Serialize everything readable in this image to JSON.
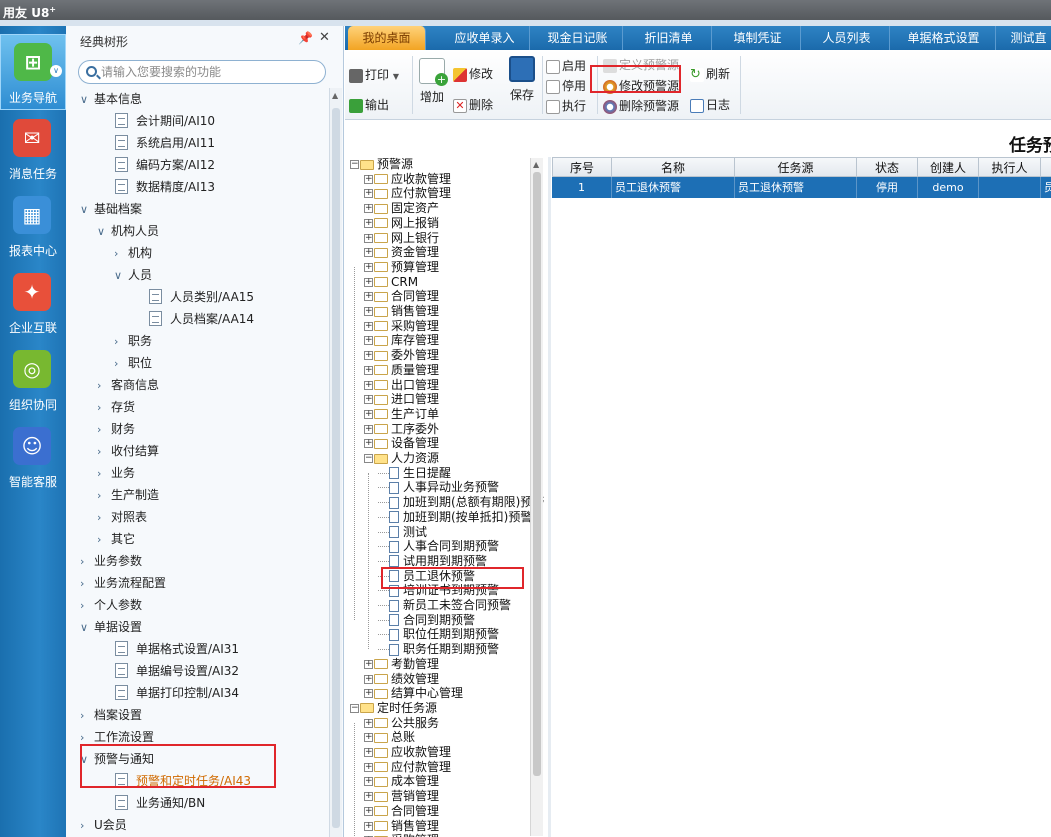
{
  "app": {
    "brand": "用友",
    "product": "U8",
    "product_sup": "+"
  },
  "rail": [
    {
      "label": "业务导航",
      "color": "#4fb848",
      "glyph": "⊞",
      "active": true
    },
    {
      "label": "消息任务",
      "color": "#e04a3a",
      "glyph": "✉"
    },
    {
      "label": "报表中心",
      "color": "#3a8fd8",
      "glyph": "▦"
    },
    {
      "label": "企业互联",
      "color": "#e8503a",
      "glyph": "✦"
    },
    {
      "label": "组织协同",
      "color": "#78b830",
      "glyph": "◎"
    },
    {
      "label": "智能客服",
      "color": "#3b6fd0",
      "glyph": "☺"
    }
  ],
  "nav": {
    "title": "经典树形",
    "pin": "📌",
    "close": "✕",
    "search_placeholder": "请输入您要搜索的功能",
    "items": [
      {
        "kind": "group",
        "chev": "∨",
        "label": "基本信息",
        "indent": 0
      },
      {
        "kind": "doc",
        "label": "会计期间/AI10",
        "indent": 1
      },
      {
        "kind": "doc",
        "label": "系统启用/AI11",
        "indent": 1
      },
      {
        "kind": "doc",
        "label": "编码方案/AI12",
        "indent": 1
      },
      {
        "kind": "doc",
        "label": "数据精度/AI13",
        "indent": 1
      },
      {
        "kind": "group",
        "chev": "∨",
        "label": "基础档案",
        "indent": 0
      },
      {
        "kind": "group",
        "chev": "∨",
        "label": "机构人员",
        "indent": 1
      },
      {
        "kind": "group",
        "chev": "›",
        "label": "机构",
        "indent": 2
      },
      {
        "kind": "group",
        "chev": "∨",
        "label": "人员",
        "indent": 2
      },
      {
        "kind": "doc",
        "label": "人员类别/AA15",
        "indent": 3
      },
      {
        "kind": "doc",
        "label": "人员档案/AA14",
        "indent": 3
      },
      {
        "kind": "group",
        "chev": "›",
        "label": "职务",
        "indent": 2
      },
      {
        "kind": "group",
        "chev": "›",
        "label": "职位",
        "indent": 2
      },
      {
        "kind": "group",
        "chev": "›",
        "label": "客商信息",
        "indent": 1
      },
      {
        "kind": "group",
        "chev": "›",
        "label": "存货",
        "indent": 1
      },
      {
        "kind": "group",
        "chev": "›",
        "label": "财务",
        "indent": 1
      },
      {
        "kind": "group",
        "chev": "›",
        "label": "收付结算",
        "indent": 1
      },
      {
        "kind": "group",
        "chev": "›",
        "label": "业务",
        "indent": 1
      },
      {
        "kind": "group",
        "chev": "›",
        "label": "生产制造",
        "indent": 1
      },
      {
        "kind": "group",
        "chev": "›",
        "label": "对照表",
        "indent": 1
      },
      {
        "kind": "group",
        "chev": "›",
        "label": "其它",
        "indent": 1
      },
      {
        "kind": "group",
        "chev": "›",
        "label": "业务参数",
        "indent": 0
      },
      {
        "kind": "group",
        "chev": "›",
        "label": "业务流程配置",
        "indent": 0
      },
      {
        "kind": "group",
        "chev": "›",
        "label": "个人参数",
        "indent": 0
      },
      {
        "kind": "group",
        "chev": "∨",
        "label": "单据设置",
        "indent": 0
      },
      {
        "kind": "doc",
        "label": "单据格式设置/AI31",
        "indent": 1
      },
      {
        "kind": "doc",
        "label": "单据编号设置/AI32",
        "indent": 1
      },
      {
        "kind": "doc",
        "label": "单据打印控制/AI34",
        "indent": 1
      },
      {
        "kind": "group",
        "chev": "›",
        "label": "档案设置",
        "indent": 0
      },
      {
        "kind": "group",
        "chev": "›",
        "label": "工作流设置",
        "indent": 0
      },
      {
        "kind": "group",
        "chev": "∨",
        "label": "预警与通知",
        "indent": 0
      },
      {
        "kind": "doc",
        "label": "预警和定时任务/AI43",
        "indent": 1,
        "orange": true
      },
      {
        "kind": "doc",
        "label": "业务通知/BN",
        "indent": 1
      },
      {
        "kind": "group",
        "chev": "›",
        "label": "U会员",
        "indent": 0
      }
    ]
  },
  "tabs": [
    "我的桌面",
    "应收单录入",
    "现金日记账",
    "折旧清单",
    "填制凭证",
    "人员列表",
    "单据格式设置",
    "测试直"
  ],
  "toolbar": {
    "print": "打印",
    "export": "输出",
    "add": "增加",
    "edit": "修改",
    "delete": "删除",
    "save": "保存",
    "enable": "启用",
    "disable": "停用",
    "execute": "执行",
    "define_source": "定义预警源",
    "modify_source": "修改预警源",
    "delete_source": "删除预警源",
    "refresh": "刷新",
    "log": "日志"
  },
  "content_title": "任务预",
  "alert_tree": [
    {
      "label": "预警源",
      "level": 0,
      "type": "open"
    },
    {
      "label": "应收款管理",
      "level": 1,
      "type": "closed"
    },
    {
      "label": "应付款管理",
      "level": 1,
      "type": "closed"
    },
    {
      "label": "固定资产",
      "level": 1,
      "type": "closed"
    },
    {
      "label": "网上报销",
      "level": 1,
      "type": "closed"
    },
    {
      "label": "网上银行",
      "level": 1,
      "type": "closed"
    },
    {
      "label": "资金管理",
      "level": 1,
      "type": "closed"
    },
    {
      "label": "预算管理",
      "level": 1,
      "type": "closed"
    },
    {
      "label": "CRM",
      "level": 1,
      "type": "closed"
    },
    {
      "label": "合同管理",
      "level": 1,
      "type": "closed"
    },
    {
      "label": "销售管理",
      "level": 1,
      "type": "closed"
    },
    {
      "label": "采购管理",
      "level": 1,
      "type": "closed"
    },
    {
      "label": "库存管理",
      "level": 1,
      "type": "closed"
    },
    {
      "label": "委外管理",
      "level": 1,
      "type": "closed"
    },
    {
      "label": "质量管理",
      "level": 1,
      "type": "closed"
    },
    {
      "label": "出口管理",
      "level": 1,
      "type": "closed"
    },
    {
      "label": "进口管理",
      "level": 1,
      "type": "closed"
    },
    {
      "label": "生产订单",
      "level": 1,
      "type": "closed"
    },
    {
      "label": "工序委外",
      "level": 1,
      "type": "closed"
    },
    {
      "label": "设备管理",
      "level": 1,
      "type": "closed"
    },
    {
      "label": "人力资源",
      "level": 1,
      "type": "open"
    },
    {
      "label": "生日提醒",
      "level": 2,
      "type": "leaf"
    },
    {
      "label": "人事异动业务预警",
      "level": 2,
      "type": "leaf"
    },
    {
      "label": "加班到期(总额有期限)预警",
      "level": 2,
      "type": "leaf"
    },
    {
      "label": "加班到期(按单抵扣)预警",
      "level": 2,
      "type": "leaf"
    },
    {
      "label": "测试",
      "level": 2,
      "type": "leaf"
    },
    {
      "label": "人事合同到期预警",
      "level": 2,
      "type": "leaf"
    },
    {
      "label": "试用期到期预警",
      "level": 2,
      "type": "leaf"
    },
    {
      "label": "员工退休预警",
      "level": 2,
      "type": "leaf"
    },
    {
      "label": "培训证书到期预警",
      "level": 2,
      "type": "leaf"
    },
    {
      "label": "新员工未签合同预警",
      "level": 2,
      "type": "leaf"
    },
    {
      "label": "合同到期预警",
      "level": 2,
      "type": "leaf"
    },
    {
      "label": "职位任期到期预警",
      "level": 2,
      "type": "leaf"
    },
    {
      "label": "职务任期到期预警",
      "level": 2,
      "type": "leaf"
    },
    {
      "label": "考勤管理",
      "level": 1,
      "type": "closed"
    },
    {
      "label": "绩效管理",
      "level": 1,
      "type": "closed"
    },
    {
      "label": "结算中心管理",
      "level": 1,
      "type": "closed"
    },
    {
      "label": "定时任务源",
      "level": 0,
      "type": "open"
    },
    {
      "label": "公共服务",
      "level": 1,
      "type": "closed"
    },
    {
      "label": "总账",
      "level": 1,
      "type": "closed"
    },
    {
      "label": "应收款管理",
      "level": 1,
      "type": "closed"
    },
    {
      "label": "应付款管理",
      "level": 1,
      "type": "closed"
    },
    {
      "label": "成本管理",
      "level": 1,
      "type": "closed"
    },
    {
      "label": "营销管理",
      "level": 1,
      "type": "closed"
    },
    {
      "label": "合同管理",
      "level": 1,
      "type": "closed"
    },
    {
      "label": "销售管理",
      "level": 1,
      "type": "closed"
    },
    {
      "label": "采购管理",
      "level": 1,
      "type": "closed"
    }
  ],
  "table": {
    "columns": [
      "序号",
      "名称",
      "任务源",
      "状态",
      "创建人",
      "执行人",
      ""
    ],
    "rows": [
      [
        "1",
        "员工退休预警",
        "员工退休预警",
        "停用",
        "demo",
        "",
        "员"
      ]
    ]
  }
}
